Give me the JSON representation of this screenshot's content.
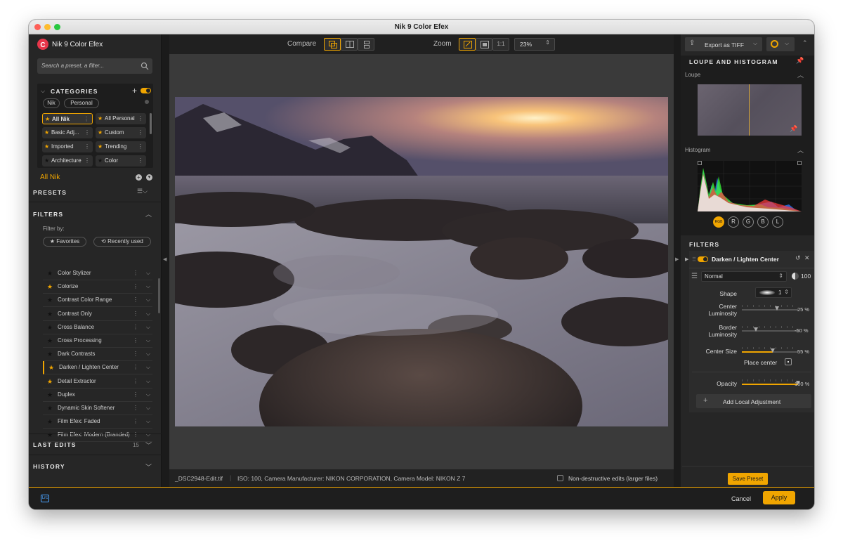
{
  "window": {
    "title": "Nik 9 Color Efex"
  },
  "app": {
    "name": "Nik 9 Color Efex",
    "accent": "#f0a500"
  },
  "left": {
    "search_placeholder": "Search a preset, a filter...",
    "categories": {
      "header": "CATEGORIES",
      "tabs": [
        "Nik",
        "Personal"
      ],
      "items": [
        {
          "label": "All Nik",
          "selected": true
        },
        {
          "label": "All Personal"
        },
        {
          "label": "Basic Adj..."
        },
        {
          "label": "Custom"
        },
        {
          "label": "Imported"
        },
        {
          "label": "Trending"
        },
        {
          "label": "Architecture"
        },
        {
          "label": "Color"
        }
      ]
    },
    "current_category": "All Nik",
    "presets_header": "PRESETS",
    "filters": {
      "header": "FILTERS",
      "filter_by": "Filter by:",
      "favorites": "Favorites",
      "recent": "Recently used",
      "items": [
        {
          "label": "Color Stylizer",
          "fav": false
        },
        {
          "label": "Colorize",
          "fav": true
        },
        {
          "label": "Contrast Color Range",
          "fav": false
        },
        {
          "label": "Contrast Only",
          "fav": false
        },
        {
          "label": "Cross Balance",
          "fav": false
        },
        {
          "label": "Cross Processing",
          "fav": false
        },
        {
          "label": "Dark Contrasts",
          "fav": false
        },
        {
          "label": "Darken / Lighten Center",
          "fav": true,
          "active": true
        },
        {
          "label": "Detail Extractor",
          "fav": true
        },
        {
          "label": "Duplex",
          "fav": false
        },
        {
          "label": "Dynamic Skin Softener",
          "fav": false
        },
        {
          "label": "Film Efex: Faded",
          "fav": false
        },
        {
          "label": "Film Efex: Modern (Branded)",
          "fav": false
        }
      ]
    },
    "last_edits": {
      "header": "LAST EDITS",
      "count": "15"
    },
    "history": {
      "header": "HISTORY"
    }
  },
  "toolbar": {
    "compare_label": "Compare",
    "zoom_label": "Zoom",
    "zoom_one": "1:1",
    "zoom_value": "23%"
  },
  "statusbar": {
    "filename": "_DSC2948-Edit.tif",
    "meta": "ISO: 100, Camera Manufacturer: NIKON CORPORATION, Camera Model: NIKON Z 7",
    "nondestructive": "Non-destructive edits (larger files)"
  },
  "right": {
    "export_label": "Export as TIFF",
    "loupe_hist_header": "LOUPE AND HISTOGRAM",
    "loupe_label": "Loupe",
    "histogram_label": "Histogram",
    "channels": [
      "RGB",
      "R",
      "G",
      "B",
      "L"
    ],
    "filters_header": "FILTERS",
    "filter": {
      "name": "Darken / Lighten Center",
      "blend_mode": "Normal",
      "opacity_value": "100",
      "shape_label": "Shape",
      "shape_value": "1",
      "controls": [
        {
          "label_line1": "Center",
          "label_line2": "Luminosity",
          "value": 25,
          "text": "25 %"
        },
        {
          "label_line1": "Border",
          "label_line2": "Luminosity",
          "value": -50,
          "text": "-50 %"
        },
        {
          "label_line1": "Center Size",
          "label_line2": "",
          "value": 55,
          "text": "55 %"
        }
      ],
      "place_center": "Place center",
      "opacity_label": "Opacity",
      "opacity_text": "100 %",
      "opacity": 100,
      "add_local": "Add Local Adjustment"
    },
    "save_preset": "Save Preset"
  },
  "bottom": {
    "lrc": "Lrc",
    "cancel": "Cancel",
    "apply": "Apply"
  }
}
